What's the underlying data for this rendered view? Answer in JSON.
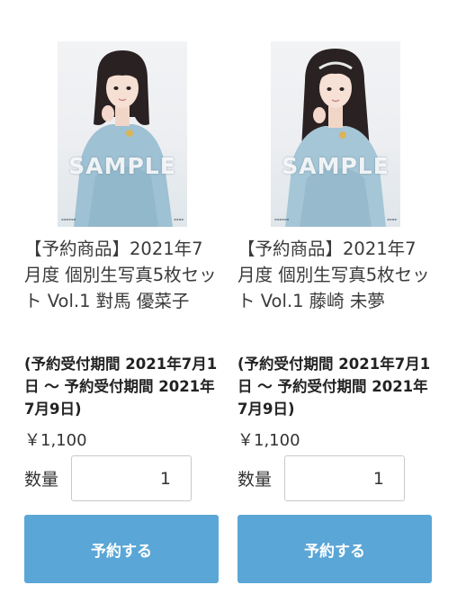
{
  "products": [
    {
      "watermark": "SAMPLE",
      "title": "【予約商品】2021年7月度 個別生写真5枚セット Vol.1 對馬 優菜子",
      "period": "(予約受付期間 2021年7月1日 〜 予約受付期間 2021年7月9日)",
      "price": "￥1,100",
      "quantity_label": "数量",
      "quantity_value": "1",
      "button_label": "予約する",
      "accent_color": "#5aa6d6"
    },
    {
      "watermark": "SAMPLE",
      "title": "【予約商品】2021年7月度 個別生写真5枚セット Vol.1 藤崎 未夢",
      "period": "(予約受付期間 2021年7月1日 〜 予約受付期間 2021年7月9日)",
      "price": "￥1,100",
      "quantity_label": "数量",
      "quantity_value": "1",
      "button_label": "予約する",
      "accent_color": "#5aa6d6"
    }
  ]
}
